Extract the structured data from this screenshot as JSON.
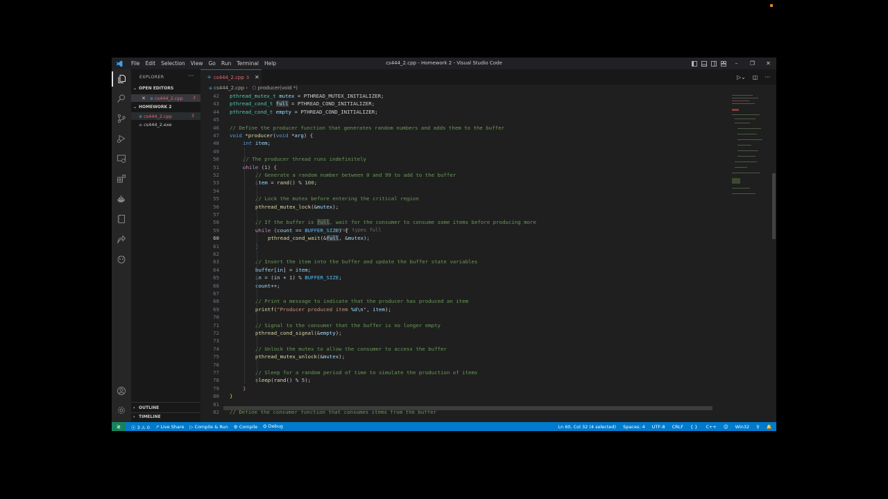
{
  "window": {
    "title": "cs444_2.cpp - Homework 2 - Visual Studio Code",
    "menu": [
      "File",
      "Edit",
      "Selection",
      "View",
      "Go",
      "Run",
      "Terminal",
      "Help"
    ]
  },
  "sidebar": {
    "header": "EXPLORER",
    "open_editors_label": "OPEN EDITORS",
    "open_editor_file": "cs444_2.cpp",
    "open_editor_badge": "3",
    "folder_label": "HOMEWORK 2",
    "files": [
      {
        "name": "cs444_2.cpp",
        "badge": "3"
      },
      {
        "name": "cs444_2.exe",
        "badge": ""
      }
    ],
    "outline_label": "OUTLINE",
    "timeline_label": "TIMELINE"
  },
  "editor": {
    "tab": {
      "name": "cs444_2.cpp",
      "badge": "3"
    },
    "breadcrumb": {
      "file": "cs444_2.cpp",
      "symbol": "producer(void *)"
    },
    "ghost_text": "error types full",
    "line_numbers": [
      "42",
      "43",
      "44",
      "45",
      "46",
      "47",
      "48",
      "49",
      "50",
      "51",
      "52",
      "53",
      "54",
      "55",
      "56",
      "57",
      "58",
      "59",
      "60",
      "61",
      "62",
      "63",
      "64",
      "65",
      "66",
      "67",
      "68",
      "69",
      "70",
      "71",
      "72",
      "73",
      "74",
      "75",
      "76",
      "77",
      "78",
      "79",
      "80",
      "81",
      "82"
    ],
    "current_line": "60"
  },
  "code": {
    "l42": {
      "t": "pthread_mutex_t",
      "v": "mutex",
      "rest": " = PTHREAD_MUTEX_INITIALIZER;"
    },
    "l43": {
      "t": "pthread_cond_t",
      "v": "full",
      "rest": " = PTHREAD_COND_INITIALIZER;"
    },
    "l44": {
      "t": "pthread_cond_t",
      "v": "empty",
      "rest": " = PTHREAD_COND_INITIALIZER;"
    },
    "l46": "// Define the producer function that generates random numbers and adds them to the buffer",
    "l47": {
      "kw": "void",
      "star": " *",
      "fn": "producer",
      "open": "(",
      "kw2": "void",
      "p": " *",
      "arg": "arg",
      "close": ") {"
    },
    "l48": {
      "kw": "int",
      "v": "item",
      "semi": ";"
    },
    "l50": "// The producer thread runs indefinitely",
    "l51": {
      "kw": "while",
      "open": " (",
      "num": "1",
      "close": ") {"
    },
    "l52": "// Generate a random number between 0 and 99 to add to the buffer",
    "l53": {
      "v": "item",
      "eq": " = ",
      "fn": "rand",
      "mid": "() % ",
      "num": "100",
      "semi": ";"
    },
    "l55": "// Lock the mutex before entering the critical region",
    "l56": {
      "fn": "pthread_mutex_lock",
      "open": "(&",
      "v": "mutex",
      "close": ");"
    },
    "l58a": "// If the buffer is ",
    "l58b": "full",
    "l58c": ", wait for the consumer to consume some items before producing more",
    "l59": {
      "kw": "while",
      "open": " (",
      "v": "count",
      "op": " == ",
      "mc": "BUFFER_SIZE",
      "close": ") {"
    },
    "l60": {
      "fn": "pthread_cond_wait",
      "open": "(&",
      "v": "full",
      "mid": ", &",
      "v2": "mutex",
      "close": ");"
    },
    "l61": "}",
    "l63": "// Insert the item into the buffer and update the buffer state variables",
    "l64": {
      "v": "buffer",
      "b1": "[",
      "v2": "in",
      "b2": "] = ",
      "v3": "item",
      "semi": ";"
    },
    "l65": {
      "v": "in",
      "mid": " = (",
      "v2": "in",
      "mid2": " + ",
      "num": "1",
      "mid3": ") % ",
      "mc": "BUFFER_SIZE",
      "semi": ";"
    },
    "l66": {
      "v": "count",
      "rest": "++;"
    },
    "l68": "// Print a message to indicate that the producer has produced an item",
    "l69": {
      "fn": "printf",
      "open": "(",
      "st": "\"Producer produced item ",
      "fmt": "%d\\n",
      "st2": "\"",
      "mid": ", ",
      "v": "item",
      "close": ");"
    },
    "l71": "// Signal to the consumer that the buffer is no longer empty",
    "l72": {
      "fn": "pthread_cond_signal",
      "open": "(&",
      "v": "empty",
      "close": ");"
    },
    "l74": "// Unlock the mutex to allow the consumer to access the buffer",
    "l75": {
      "fn": "pthread_mutex_unlock",
      "open": "(&",
      "v": "mutex",
      "close": ");"
    },
    "l77": "// Sleep for a random period of time to simulate the production of items",
    "l78": {
      "fn": "sleep",
      "open": "(",
      "fn2": "rand",
      "mid": "() % ",
      "num": "5",
      "close": ");"
    },
    "l79": "}",
    "l80": "}",
    "l82": "// Define the consumer function that consumes items from the buffer"
  },
  "status": {
    "problems": "3",
    "warnings": "0",
    "live_share": "Live Share",
    "compile_run": "Compile & Run",
    "compile": "Compile",
    "debug": "Debug",
    "position": "Ln 60, Col 32 (4 selected)",
    "spaces": "Spaces: 4",
    "encoding": "UTF-8",
    "eol": "CRLF",
    "language": "C++",
    "platform": "Win32"
  },
  "colors": {
    "status_bar": "#007acc",
    "error": "#e06c75",
    "keyword": "#569cd6",
    "comment": "#6a9955"
  }
}
